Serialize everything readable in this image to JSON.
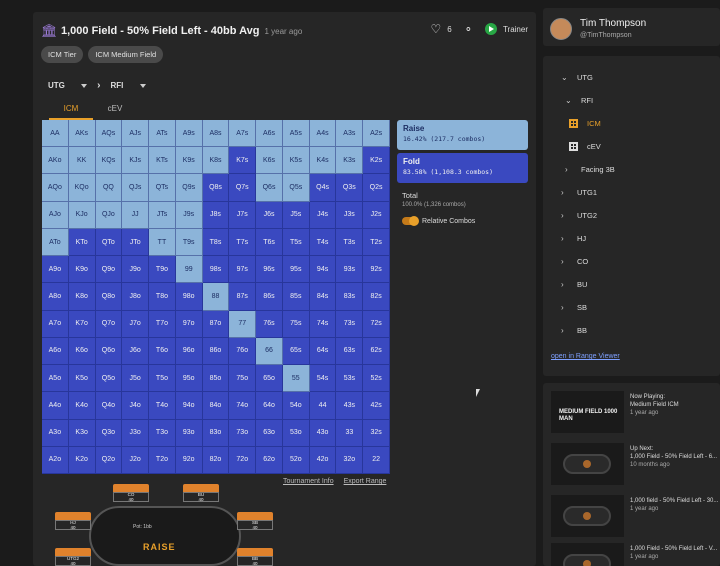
{
  "header": {
    "title": "1,000 Field - 50% Field Left - 40bb Avg",
    "ago": "1 year ago",
    "likes": "6",
    "trainer_label": "Trainer"
  },
  "chips": [
    "ICM Tier",
    "ICM Medium Field"
  ],
  "path": {
    "position": "UTG",
    "action": "RFI"
  },
  "tabs": [
    "ICM",
    "cEV"
  ],
  "grid": {
    "cells": [
      [
        "AA",
        "AKs",
        "AQs",
        "AJs",
        "ATs",
        "A9s",
        "A8s",
        "A7s",
        "A6s",
        "A5s",
        "A4s",
        "A3s",
        "A2s"
      ],
      [
        "AKo",
        "KK",
        "KQs",
        "KJs",
        "KTs",
        "K9s",
        "K8s",
        "K7s",
        "K6s",
        "K5s",
        "K4s",
        "K3s",
        "K2s"
      ],
      [
        "AQo",
        "KQo",
        "QQ",
        "QJs",
        "QTs",
        "Q9s",
        "Q8s",
        "Q7s",
        "Q6s",
        "Q5s",
        "Q4s",
        "Q3s",
        "Q2s"
      ],
      [
        "AJo",
        "KJo",
        "QJo",
        "JJ",
        "JTs",
        "J9s",
        "J8s",
        "J7s",
        "J6s",
        "J5s",
        "J4s",
        "J3s",
        "J2s"
      ],
      [
        "ATo",
        "KTo",
        "QTo",
        "JTo",
        "TT",
        "T9s",
        "T8s",
        "T7s",
        "T6s",
        "T5s",
        "T4s",
        "T3s",
        "T2s"
      ],
      [
        "A9o",
        "K9o",
        "Q9o",
        "J9o",
        "T9o",
        "99",
        "98s",
        "97s",
        "96s",
        "95s",
        "94s",
        "93s",
        "92s"
      ],
      [
        "A8o",
        "K8o",
        "Q8o",
        "J8o",
        "T8o",
        "98o",
        "88",
        "87s",
        "86s",
        "85s",
        "84s",
        "83s",
        "82s"
      ],
      [
        "A7o",
        "K7o",
        "Q7o",
        "J7o",
        "T7o",
        "97o",
        "87o",
        "77",
        "76s",
        "75s",
        "74s",
        "73s",
        "72s"
      ],
      [
        "A6o",
        "K6o",
        "Q6o",
        "J6o",
        "T6o",
        "96o",
        "86o",
        "76o",
        "66",
        "65s",
        "64s",
        "63s",
        "62s"
      ],
      [
        "A5o",
        "K5o",
        "Q5o",
        "J5o",
        "T5o",
        "95o",
        "85o",
        "75o",
        "65o",
        "55",
        "54s",
        "53s",
        "52s"
      ],
      [
        "A4o",
        "K4o",
        "Q4o",
        "J4o",
        "T4o",
        "94o",
        "84o",
        "74o",
        "64o",
        "54o",
        "44",
        "43s",
        "42s"
      ],
      [
        "A3o",
        "K3o",
        "Q3o",
        "J3o",
        "T3o",
        "93o",
        "83o",
        "73o",
        "63o",
        "53o",
        "43o",
        "33",
        "32s"
      ],
      [
        "A2o",
        "K2o",
        "Q2o",
        "J2o",
        "T2o",
        "92o",
        "82o",
        "72o",
        "62o",
        "52o",
        "42o",
        "32o",
        "22"
      ]
    ],
    "raise_hands": [
      "AA",
      "AKs",
      "AQs",
      "AJs",
      "ATs",
      "A9s",
      "A8s",
      "A7s",
      "A6s",
      "A5s",
      "A4s",
      "A3s",
      "AKo",
      "KK",
      "KQs",
      "KJs",
      "KTs",
      "K9s",
      "K8s",
      "K6s",
      "K4s",
      "K3s",
      "AQo",
      "KQo",
      "QQ",
      "QJs",
      "QTs",
      "Q9s",
      "Q6s",
      "AJo",
      "KJo",
      "QJo",
      "JJ",
      "JTs",
      "J9s",
      "ATo",
      "TT",
      "T9s",
      "99",
      "88",
      "77",
      "66",
      "55",
      "K5s",
      "Q5s",
      "A2s"
    ]
  },
  "grid_links": {
    "info": "Tournament Info",
    "export": "Export Range"
  },
  "legend": {
    "raise_title": "Raise",
    "raise_stats": "16.42% (217.7 combos)",
    "fold_title": "Fold",
    "fold_stats": "83.58% (1,108.3 combos)",
    "total_title": "Total",
    "total_stats": "100.0% (1,326 combos)",
    "relative_label": "Relative Combos"
  },
  "table": {
    "pot": "Pot: 1bb",
    "logo": "RAISE",
    "seats": [
      {
        "name": "CO",
        "stack": "40"
      },
      {
        "name": "BU",
        "stack": "40"
      },
      {
        "name": "HJ",
        "stack": "40"
      },
      {
        "name": "SB",
        "stack": "40"
      },
      {
        "name": "UTG2",
        "stack": "40"
      },
      {
        "name": "BB",
        "stack": "40"
      }
    ]
  },
  "user": {
    "name": "Tim Thompson",
    "handle": "@TimThompson"
  },
  "tree": {
    "items": [
      "UTG",
      "RFI",
      "ICM",
      "cEV",
      "Facing 3B",
      "UTG1",
      "UTG2",
      "HJ",
      "CO",
      "BU",
      "SB",
      "BB"
    ],
    "open_link": "open in Range Viewer"
  },
  "videos": [
    {
      "title": "Now Playing:",
      "sub": "Medium Field ICM",
      "ago": "1 year ago",
      "thumb": "MEDIUM FIELD 1000 MAN"
    },
    {
      "title": "Up Next:",
      "sub": "1,000 Field - 50% Field Left - 6...",
      "ago": "10 months ago"
    },
    {
      "title": "1,000 field - 50% Field Left - 30...",
      "sub": "1 year ago",
      "ago": ""
    },
    {
      "title": "1,000 Field - 50% Field Left - V...",
      "sub": "1 year ago",
      "ago": ""
    }
  ],
  "colors": {
    "raise": "#8cb4d9",
    "fold": "#3a49c0",
    "accent": "#e8a02a"
  }
}
